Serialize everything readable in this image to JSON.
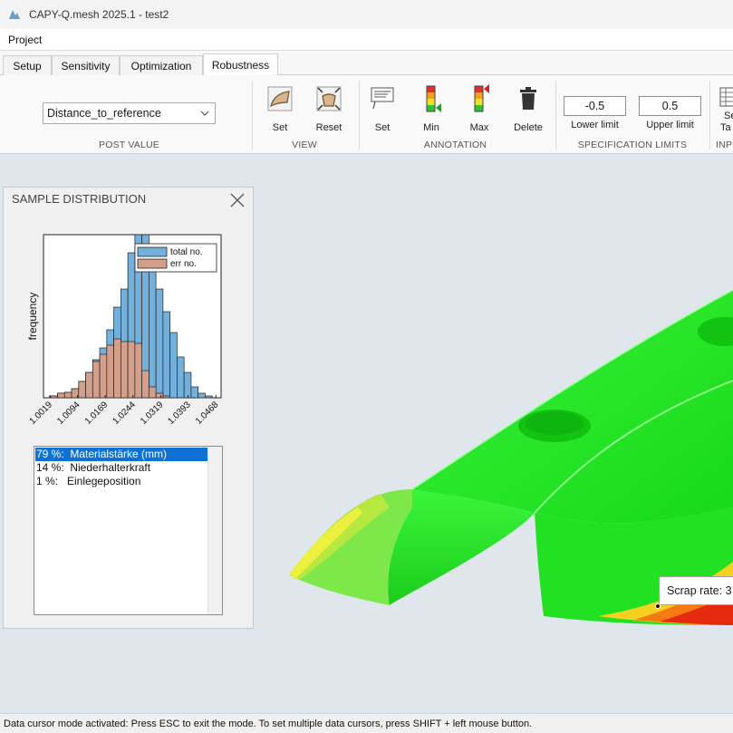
{
  "window": {
    "title": "CAPY-Q.mesh 2025.1 - test2"
  },
  "menu": {
    "project": "Project"
  },
  "tabs": [
    {
      "label": "Setup"
    },
    {
      "label": "Sensitivity"
    },
    {
      "label": "Optimization"
    },
    {
      "label": "Robustness",
      "active": true
    }
  ],
  "ribbon": {
    "post_value": {
      "selected": "Distance_to_reference",
      "group_label": "POST VALUE"
    },
    "view": {
      "set_label": "Set",
      "reset_label": "Reset",
      "group_label": "VIEW"
    },
    "annotation": {
      "set_label": "Set",
      "min_label": "Min",
      "max_label": "Max",
      "delete_label": "Delete",
      "group_label": "ANNOTATION"
    },
    "spec_limits": {
      "lower_value": "-0.5",
      "upper_value": "0.5",
      "lower_label": "Lower limit",
      "upper_label": "Upper limit",
      "group_label": "SPECIFICATION LIMITS"
    },
    "input": {
      "button_label_line1": "Se",
      "button_label_line2": "Ta",
      "group_label": "INPU"
    }
  },
  "sample_panel": {
    "title": "SAMPLE DISTRIBUTION",
    "ylabel": "frequency",
    "legend": [
      "total no.",
      "err no."
    ],
    "list": [
      {
        "text": "79 %:  Materialstärke (mm)",
        "selected": true
      },
      {
        "text": "14 %:  Niederhalterkraft",
        "selected": false
      },
      {
        "text": "1 %:   Einlegeposition",
        "selected": false
      }
    ]
  },
  "chart_data": {
    "type": "bar",
    "ylabel": "frequency",
    "x_tick_labels": [
      "1.0019",
      "1.0094",
      "1.0169",
      "1.0244",
      "1.0319",
      "1.0393",
      "1.0468"
    ],
    "xlim": [
      1.0002,
      1.0482
    ],
    "ylim": [
      0,
      180
    ],
    "bin_width": 0.0019,
    "bin_start": 1.0002,
    "series": [
      {
        "name": "total no.",
        "color": "#74b0dc",
        "values": [
          0,
          2,
          5,
          6,
          10,
          18,
          28,
          42,
          55,
          75,
          100,
          120,
          160,
          185,
          185,
          145,
          120,
          95,
          72,
          45,
          28,
          12,
          5,
          2,
          0
        ]
      },
      {
        "name": "err no.",
        "color": "#d39f8a",
        "values": [
          0,
          2,
          5,
          6,
          10,
          18,
          28,
          40,
          48,
          58,
          65,
          62,
          62,
          60,
          30,
          12,
          5,
          2,
          0,
          0,
          0,
          0,
          0,
          0,
          0
        ]
      }
    ]
  },
  "viewport": {
    "tooltip": "Scrap rate: 3"
  },
  "status": {
    "text": "Data cursor mode activated: Press ESC to exit the mode. To set multiple data cursors, press SHIFT + left mouse button."
  },
  "colors": {
    "accent": "#0f71d4",
    "part_green": "#22ee22",
    "hist_blue": "#74b0dc",
    "hist_red": "#d39f8a"
  }
}
